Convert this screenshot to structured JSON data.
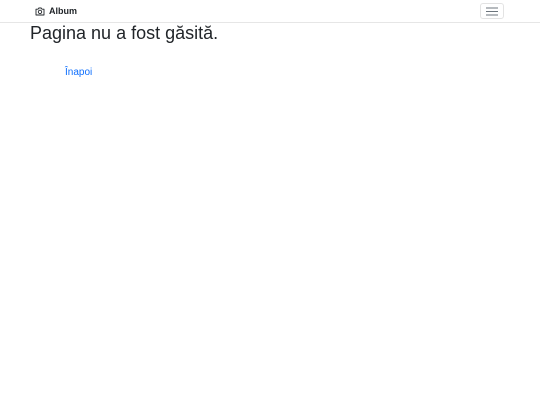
{
  "navbar": {
    "brand_label": "Album",
    "brand_icon": "camera-icon",
    "menu_icon": "hamburger-menu-icon"
  },
  "main": {
    "title": "Pagina nu a fost găsită.",
    "back_link": "Înapoi"
  },
  "colors": {
    "link": "#0d6efd",
    "text": "#212529",
    "navbar_border": "#e6e6e6"
  }
}
